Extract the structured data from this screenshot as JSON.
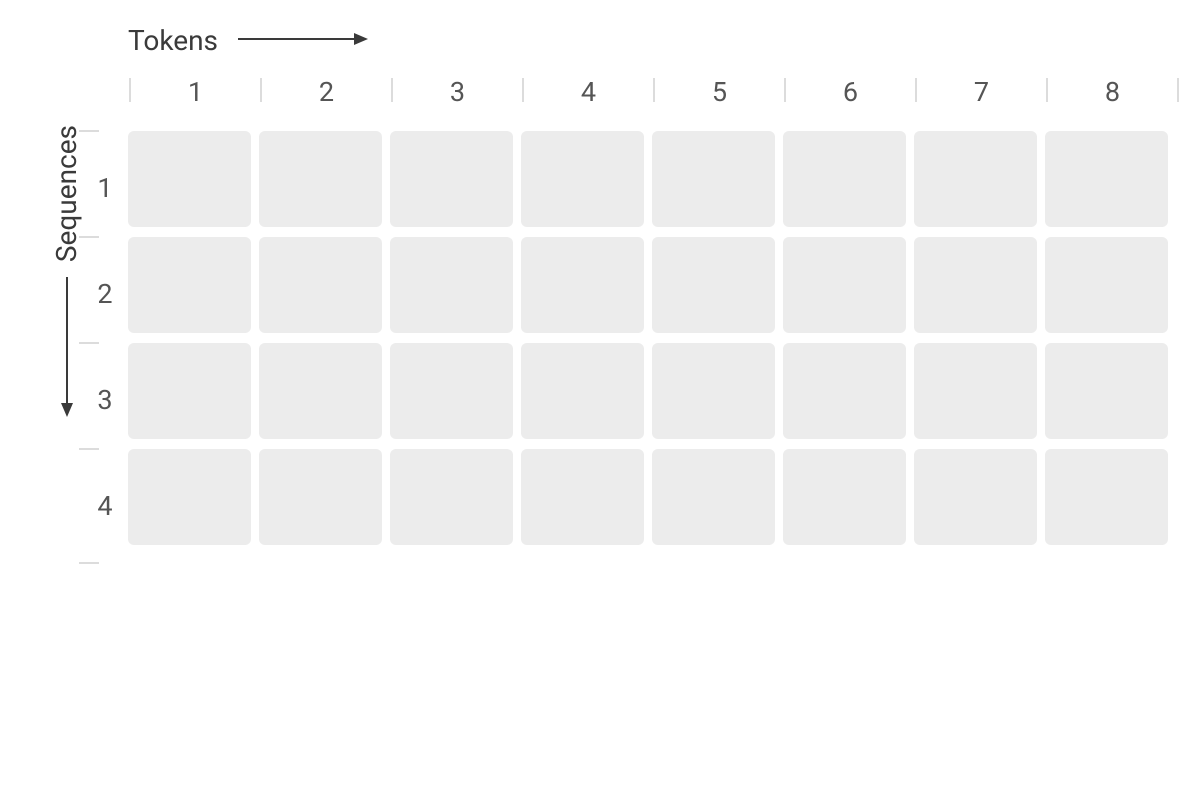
{
  "diagram": {
    "axis_x_label": "Tokens",
    "axis_y_label": "Sequences",
    "col_labels": [
      "1",
      "2",
      "3",
      "4",
      "5",
      "6",
      "7",
      "8"
    ],
    "row_labels": [
      "1",
      "2",
      "3",
      "4"
    ],
    "num_cols": 8,
    "num_rows": 4,
    "cell_color": "#ececec",
    "tick_color": "#dcdcdc",
    "label_color": "#3a3a3a",
    "number_color": "#555555"
  }
}
